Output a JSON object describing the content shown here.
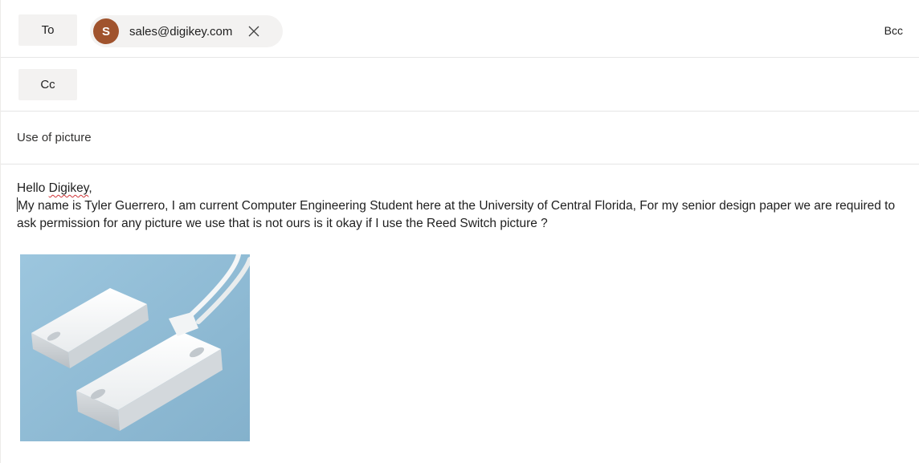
{
  "to_row": {
    "button_label": "To",
    "recipient": {
      "avatar_initial": "S",
      "avatar_color": "#a0532d",
      "email": "sales@digikey.com",
      "remove_icon": "close-icon"
    },
    "bcc_label": "Bcc"
  },
  "cc_row": {
    "button_label": "Cc"
  },
  "subject": {
    "value": "Use of picture"
  },
  "body": {
    "greeting_prefix": "Hello ",
    "greeting_name": "Digikey",
    "greeting_suffix": ",",
    "paragraph": "My name is Tyler Guerrero, I am current Computer Engineering Student here at the University of Central Florida, For my senior design paper we are required to ask permission for any picture we use that is not ours is it okay if I use the Reed Switch picture ?"
  },
  "attachment": {
    "kind": "inline-image",
    "subject": "reed-switch-photo"
  }
}
